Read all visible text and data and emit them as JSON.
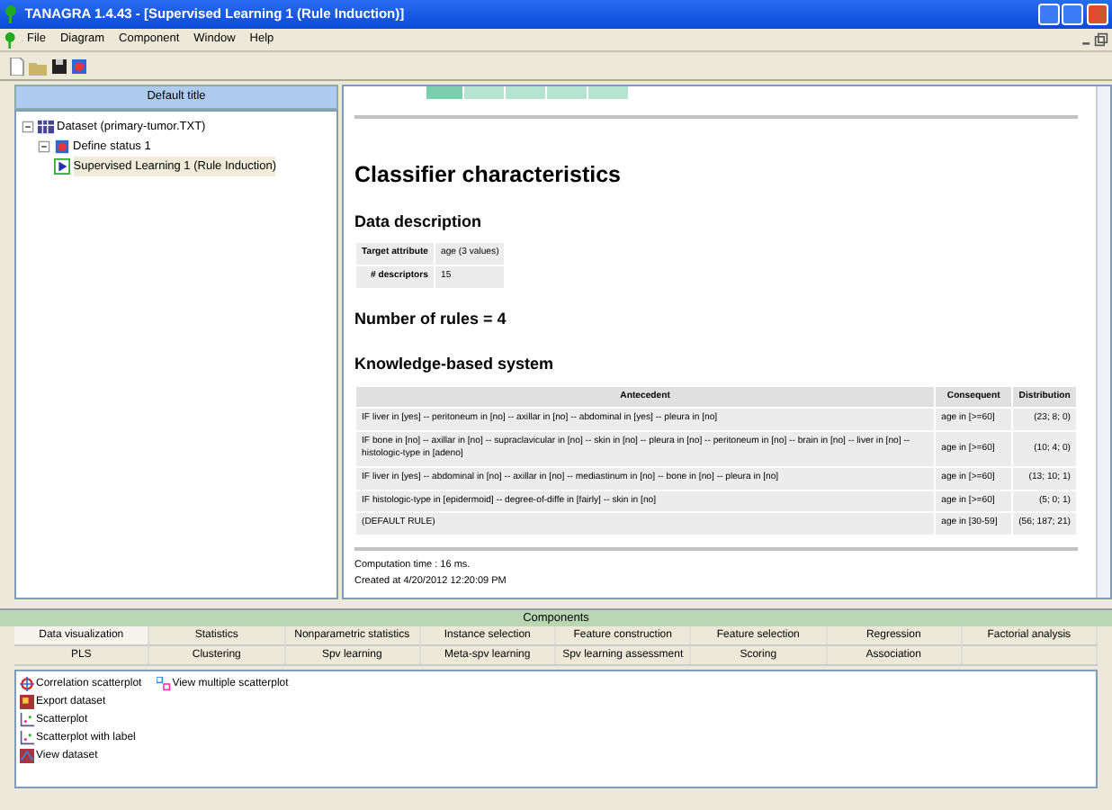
{
  "window": {
    "title": "TANAGRA 1.4.43 - [Supervised Learning 1 (Rule Induction)]"
  },
  "menu": [
    "File",
    "Diagram",
    "Component",
    "Window",
    "Help"
  ],
  "tree": {
    "title": "Default title",
    "items": [
      {
        "label": "Dataset (primary-tumor.TXT)",
        "kind": "dataset",
        "expanded": true,
        "selected": false,
        "children": [
          {
            "label": "Define status 1",
            "kind": "status",
            "expanded": true,
            "selected": false,
            "children": [
              {
                "label": "Supervised Learning 1 (Rule Induction)",
                "kind": "learner",
                "selected": true
              }
            ]
          }
        ]
      }
    ]
  },
  "report": {
    "heading": "Classifier characteristics",
    "data_description": {
      "title": "Data description",
      "rows": [
        [
          "Target attribute",
          "age (3 values)"
        ],
        [
          "# descriptors",
          "15"
        ]
      ]
    },
    "rules_count": "Number of rules = 4",
    "kbs": {
      "title": "Knowledge-based system",
      "columns": [
        "Antecedent",
        "Consequent",
        "Distribution"
      ],
      "rows": [
        [
          "IF liver in [yes] -- peritoneum in [no] -- axillar in [no] -- abdominal in [yes] -- pleura in [no]",
          "age in [>=60]",
          "(23; 8; 0)"
        ],
        [
          "IF bone in [no] -- axillar in [no] -- supraclavicular in [no] -- skin in [no] -- pleura in [no] -- peritoneum in [no] -- brain in [no] -- liver in [no] -- histologic-type in [adeno]",
          "age in [>=60]",
          "(10; 4; 0)"
        ],
        [
          "IF liver in [yes] -- abdominal in [no] -- axillar in [no] -- mediastinum in [no] -- bone in [no] -- pleura in [no]",
          "age in [>=60]",
          "(13; 10; 1)"
        ],
        [
          "IF histologic-type in [epidermoid] -- degree-of-diffe in [fairly] -- skin in [no]",
          "age in [>=60]",
          "(5; 0; 1)"
        ],
        [
          "(DEFAULT RULE)",
          "age in [30-59]",
          "(56; 187; 21)"
        ]
      ]
    },
    "computation": "Computation time : 16 ms.",
    "created": "Created at 4/20/2012 12:20:09 PM"
  },
  "components": {
    "title": "Components",
    "tabs": [
      [
        {
          "label": "Data visualization",
          "selected": true
        },
        {
          "label": "Statistics",
          "selected": false
        },
        {
          "label": "Nonparametric statistics",
          "selected": false
        },
        {
          "label": "Instance selection",
          "selected": false
        },
        {
          "label": "Feature construction",
          "selected": false
        },
        {
          "label": "Feature selection",
          "selected": false
        },
        {
          "label": "Regression",
          "selected": false
        },
        {
          "label": "Factorial analysis",
          "selected": false
        }
      ],
      [
        {
          "label": "PLS",
          "selected": false
        },
        {
          "label": "Clustering",
          "selected": false
        },
        {
          "label": "Spv learning",
          "selected": false
        },
        {
          "label": "Meta-spv learning",
          "selected": false
        },
        {
          "label": "Spv learning assessment",
          "selected": false
        },
        {
          "label": "Scoring",
          "selected": false
        },
        {
          "label": "Association",
          "selected": false
        }
      ]
    ],
    "items": [
      {
        "label": "Correlation scatterplot",
        "kind": "target"
      },
      {
        "label": "Export dataset",
        "kind": "export"
      },
      {
        "label": "Scatterplot",
        "kind": "scatter"
      },
      {
        "label": "Scatterplot with label",
        "kind": "scatter"
      },
      {
        "label": "View dataset",
        "kind": "view"
      },
      {
        "label": "View multiple scatterplot",
        "kind": "multi"
      }
    ]
  }
}
